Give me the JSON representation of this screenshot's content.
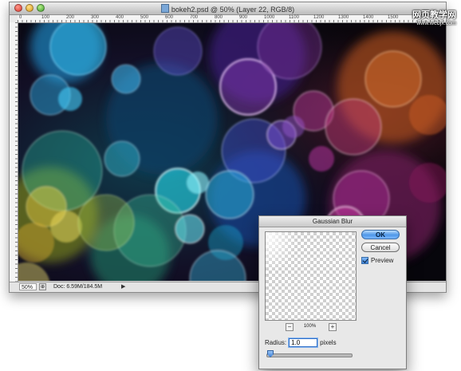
{
  "window": {
    "title": "bokeh2.psd @ 50% (Layer 22, RGB/8)",
    "ruler_labels": [
      "0",
      "100",
      "200",
      "300",
      "400",
      "500",
      "600",
      "700",
      "800",
      "900",
      "1000",
      "1100",
      "1200",
      "1300",
      "1400",
      "1500",
      "1600"
    ]
  },
  "statusbar": {
    "zoom": "50%",
    "doc_info": "Doc: 6.59M/184.5M",
    "arrow_icon": "triangle-right-icon"
  },
  "watermark": {
    "line1": "网页教学网",
    "line2": "www.webjx.com"
  },
  "dialog": {
    "title": "Gaussian Blur",
    "ok_label": "OK",
    "cancel_label": "Cancel",
    "preview_label": "Preview",
    "preview_checked": true,
    "zoom_level": "100%",
    "zoom_minus": "−",
    "zoom_plus": "+",
    "radius_label": "Radius:",
    "radius_value": "1.0",
    "radius_unit": "pixels",
    "accent_color": "#4f97e8"
  }
}
